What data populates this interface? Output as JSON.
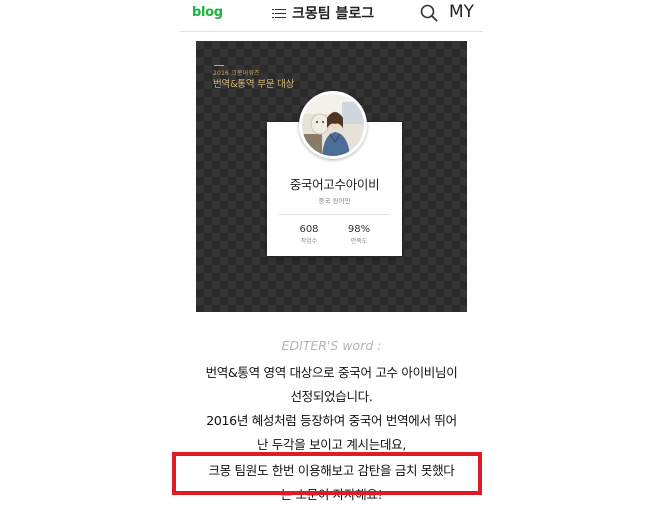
{
  "header": {
    "logo": "blog",
    "blog_title": "크몽팀 블로그",
    "my_label": "MY",
    "icons": {
      "menu": "menu-icon",
      "search": "search-icon"
    }
  },
  "hero": {
    "year_text": "2016 크몽어워즈",
    "award_text": "번역&통역 부문 대상",
    "profile": {
      "name": "중국어고수아이비",
      "role": "중국 원어민",
      "stats": [
        {
          "value": "608",
          "label": "작업수"
        },
        {
          "value": "98%",
          "label": "만족도"
        }
      ]
    }
  },
  "article": {
    "editor_label": "EDITER'S word :",
    "lines": [
      "번역&통역 영역 대상으로 중국어 고수 아이비님이",
      "선정되었습니다.",
      "2016년 혜성처럼 등장하여 중국어 번역에서 뛰어",
      "난 두각을 보이고 계시는데요,",
      "크몽 팀원도 한번 이용해보고 감탄을 금치 못했다",
      "는 소문이 자자해요!"
    ]
  },
  "colors": {
    "logo_green": "#19b33e",
    "highlight_red": "#e01b24",
    "award_gold": "#d9b873"
  }
}
